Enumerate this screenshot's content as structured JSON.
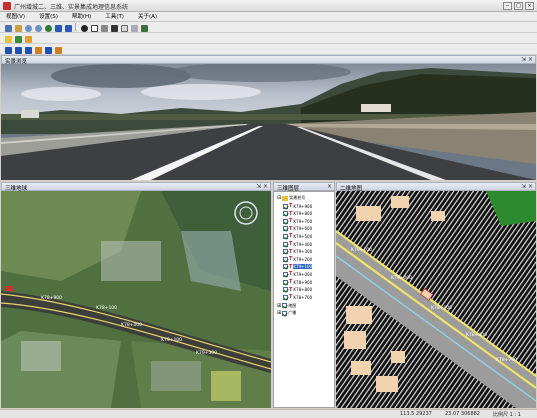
{
  "window": {
    "title": "广州增城二、三维、实景集成地理信息系统",
    "controls": [
      "−",
      "□",
      "×"
    ]
  },
  "menu": [
    "视图(V)",
    "设置(S)",
    "帮助(H)",
    "工具(T)",
    "关于(A)"
  ],
  "toolbars": {
    "row1_icons": [
      "arrow-icon",
      "pan-icon",
      "zoom-in-icon",
      "zoom-out-icon",
      "globe-icon",
      "back-icon",
      "forward-icon",
      "info-icon",
      "select-icon",
      "measure-icon",
      "area-icon",
      "layer-icon",
      "print-icon",
      "save-icon"
    ],
    "row2_icons": [
      "open-folder-icon",
      "image-icon",
      "export-icon"
    ],
    "row3_icons": [
      "play-icon",
      "first-icon",
      "prev-icon",
      "rewind-icon",
      "next-icon",
      "last-icon"
    ]
  },
  "panels": {
    "streetview": {
      "title": "实景浏览",
      "pin": "⇲ ×"
    },
    "map3d": {
      "title": "三维地球",
      "pin": "⇲ ×"
    },
    "layers": {
      "title": "三维图层",
      "pin": "×"
    },
    "map2d": {
      "title": "二维地图",
      "pin": "⇲ ×"
    }
  },
  "layer_tree": {
    "root": "实景桩号",
    "items": [
      "K79+900",
      "K79+800",
      "K79+700",
      "K79+600",
      "K79+500",
      "K79+400",
      "K79+300",
      "K79+200",
      "K79+100",
      "K79+000",
      "K78+900",
      "K78+800",
      "K78+700"
    ],
    "selected_index": 8,
    "groups": [
      "地图",
      "广播"
    ]
  },
  "map_labels": {
    "sat": [
      "K78+900",
      "K78+100",
      "K78+000",
      "K79+100",
      "K79+300"
    ],
    "map2d": [
      "K79+100",
      "K79+000",
      "K78+900",
      "K78+800",
      "K78+700"
    ]
  },
  "statusbar": {
    "coords": "113.5 29237",
    "coords2": "23.07 306882",
    "scale": "比例尺 1 : 1"
  },
  "colors": {
    "panel_header": "#cfd6e2",
    "road_yellow": "#f1e26a",
    "selected": "#3169c6"
  }
}
